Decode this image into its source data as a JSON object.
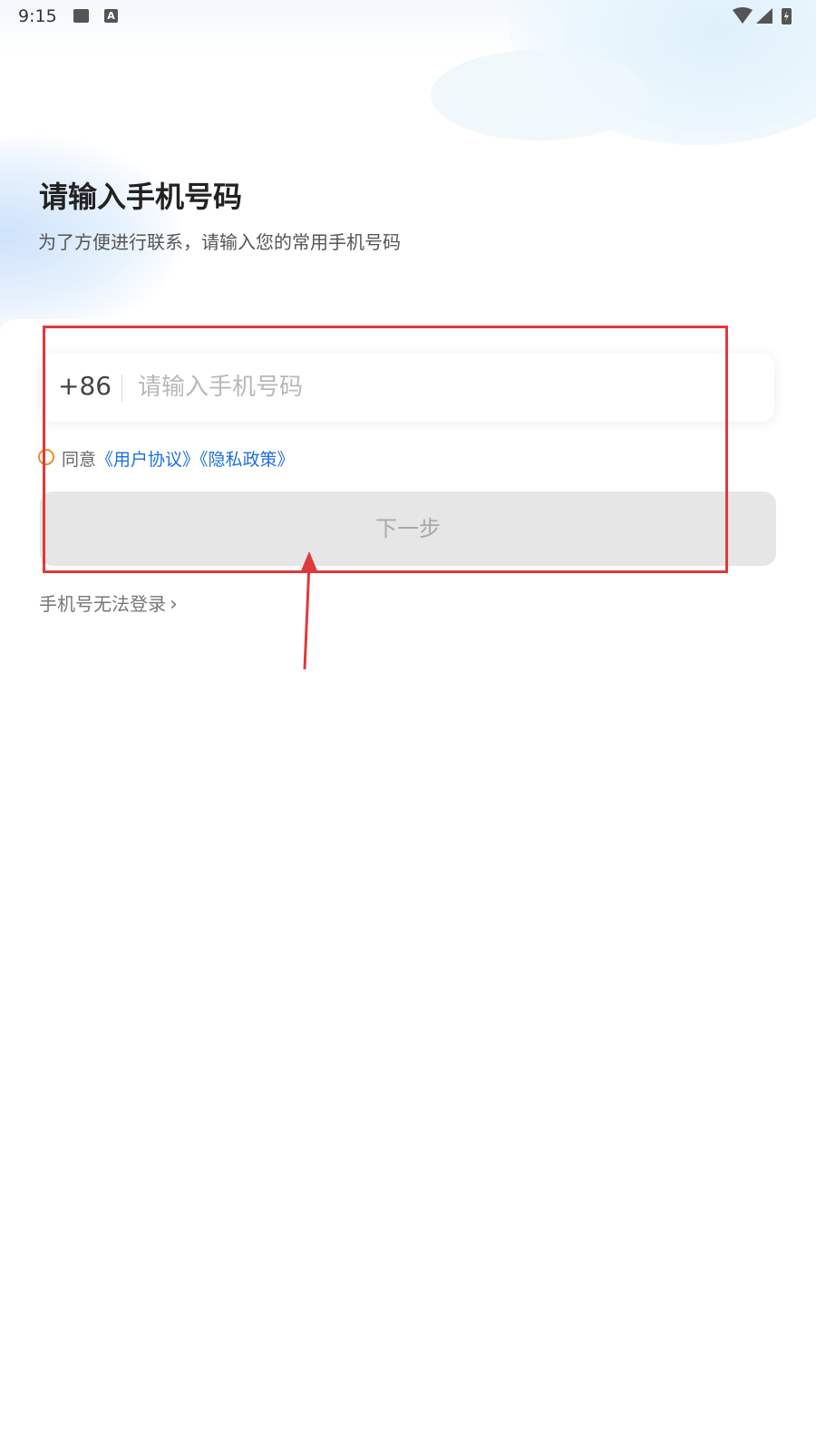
{
  "status_bar": {
    "time": "9:15",
    "a_icon_letter": "A",
    "icons": [
      "image-icon",
      "a-notification-icon",
      "wifi-icon",
      "signal-icon",
      "battery-icon"
    ]
  },
  "header": {
    "title": "请输入手机号码",
    "subtitle": "为了方便进行联系，请输入您的常用手机号码"
  },
  "phone_form": {
    "country_code": "+86",
    "phone_placeholder": "请输入手机号码",
    "phone_value": ""
  },
  "agreement": {
    "prefix": "同意",
    "user_agreement": "《用户协议》",
    "privacy_policy": "《隐私政策》",
    "checked": false
  },
  "actions": {
    "next_label": "下一步",
    "cannot_login_label": "手机号无法登录",
    "cannot_login_chevron": "›"
  },
  "colors": {
    "accent_link": "#1f6fe0",
    "radio_border": "#f08a24",
    "button_disabled_bg": "#e6e6e6",
    "button_disabled_text": "#a9a9a9",
    "annotation": "#e0393c"
  }
}
